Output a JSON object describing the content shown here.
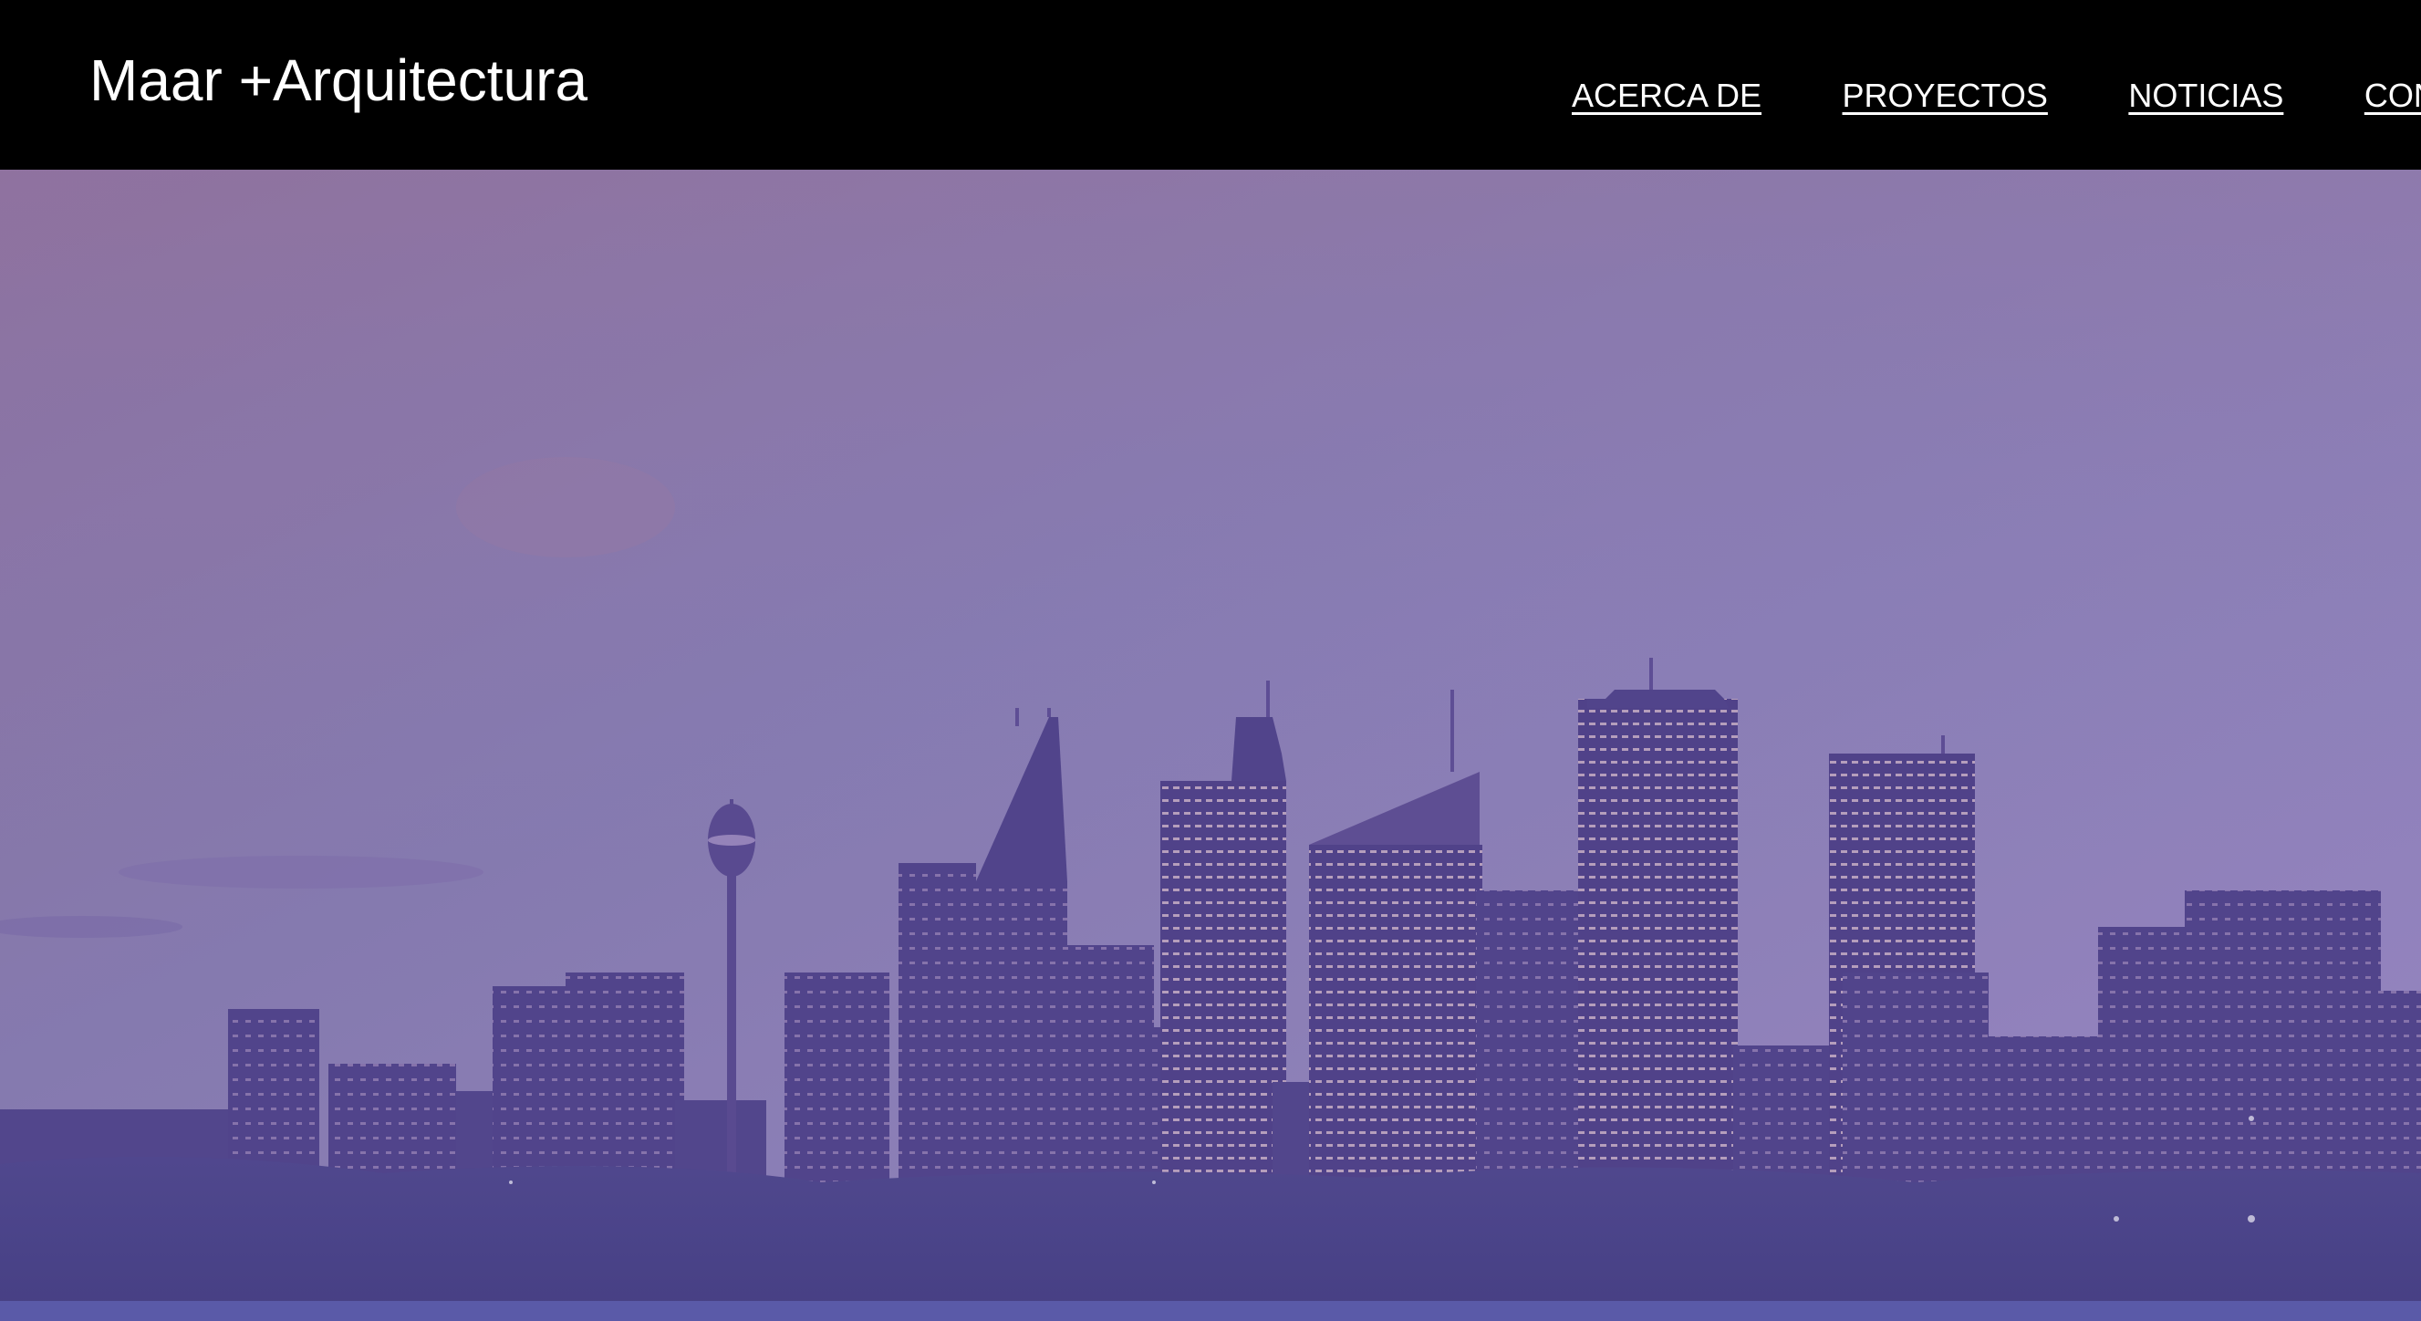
{
  "header": {
    "brand": "Maar +Arquitectura",
    "nav": [
      "ACERCA DE",
      "PROYECTOS",
      "NOTICIAS",
      "CONTACTO"
    ]
  },
  "hero": {
    "image": "city-skyline-at-dusk",
    "overlay_color": "#7f6fc0"
  },
  "colors": {
    "header_bg": "#000000",
    "text": "#ffffff",
    "sky_top": "#8d7aa6",
    "sky_bottom": "#8a82c6",
    "buildings": "#4a3f84",
    "foreground": "#433c7f"
  }
}
